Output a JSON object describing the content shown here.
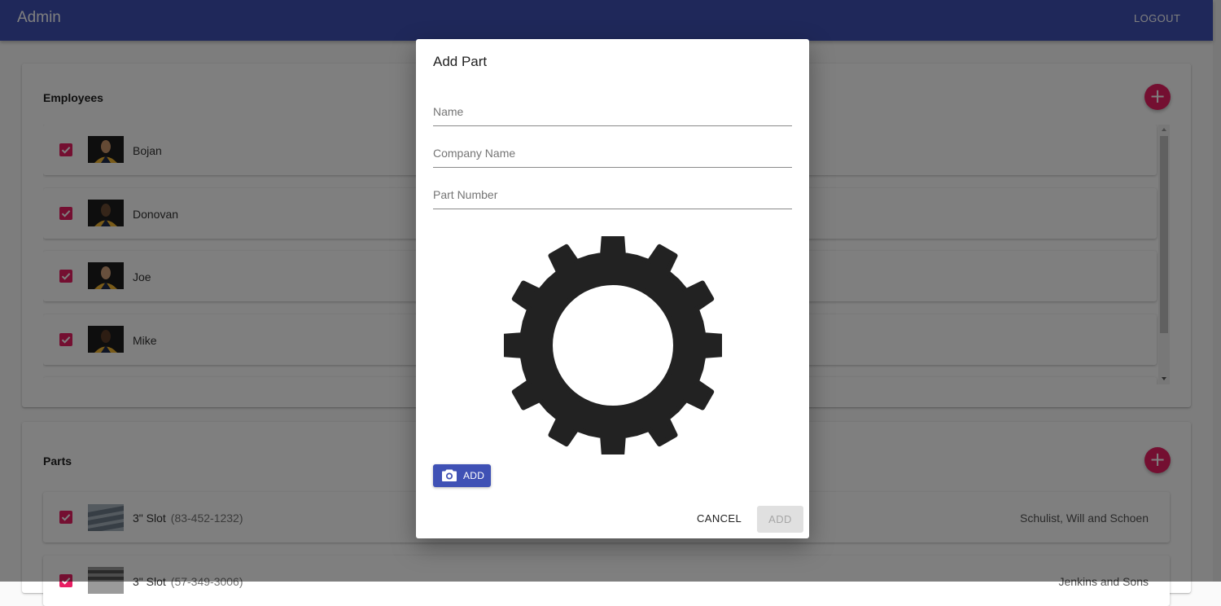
{
  "appbar": {
    "title": "Admin",
    "logout_label": "LOGOUT"
  },
  "employees": {
    "title": "Employees",
    "add_icon": "plus-icon",
    "items": [
      {
        "name": "Bojan",
        "checked": true
      },
      {
        "name": "Donovan",
        "checked": true
      },
      {
        "name": "Joe",
        "checked": true
      },
      {
        "name": "Mike",
        "checked": true
      }
    ]
  },
  "parts": {
    "title": "Parts",
    "add_icon": "plus-icon",
    "items": [
      {
        "name": "3\" Slot",
        "number": "(83-452-1232)",
        "company": "Schulist, Will and Schoen",
        "checked": true
      },
      {
        "name": "3\" Slot",
        "number": "(57-349-3006)",
        "company": "Jenkins and Sons",
        "checked": true
      }
    ]
  },
  "dialog": {
    "title": "Add Part",
    "name_placeholder": "Name",
    "company_placeholder": "Company Name",
    "part_number_placeholder": "Part Number",
    "placeholder_image_icon": "gear-icon",
    "upload_icon": "camera-icon",
    "upload_label": "ADD",
    "cancel_label": "CANCEL",
    "submit_label": "ADD"
  },
  "colors": {
    "primary": "#3f51b5",
    "accent": "#e91e63"
  }
}
